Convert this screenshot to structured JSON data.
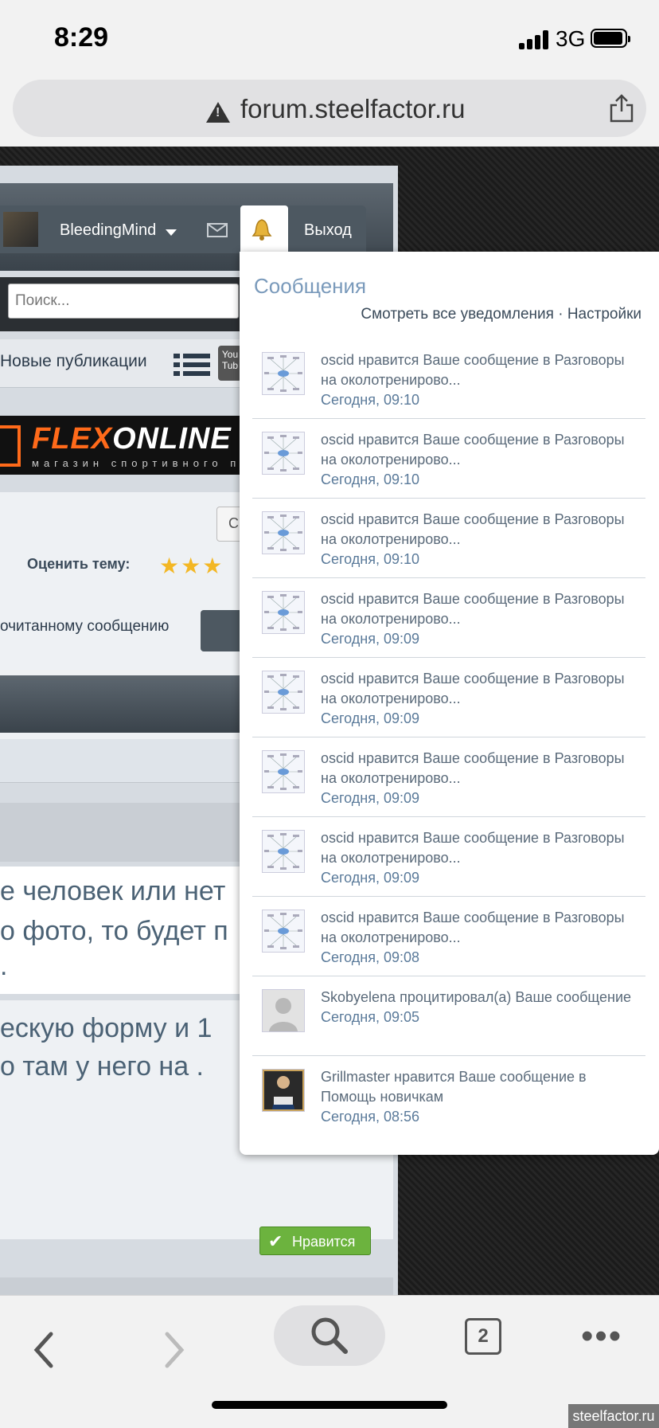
{
  "status_bar": {
    "time": "8:29",
    "network": "3G"
  },
  "browser": {
    "url": "forum.steelfactor.ru",
    "tabs_count": "2"
  },
  "site": {
    "username": "BleedingMind",
    "logout_label": "Выход",
    "search_placeholder": "Поиск...",
    "new_publications": "Новые публикации",
    "youtube_label": "You Tub",
    "banner_text_orange": "FLEX",
    "banner_text_white": "ONLINE",
    "banner_subtext": "магазин спортивного п",
    "small_button_label": "С",
    "rate_label": "Оценить тему:",
    "stars": "★★★",
    "unread_text": "очитанному сообщению",
    "post_lines": [
      "е человек или нет",
      "о фото, то будет п",
      ".",
      "ескую форму и 1",
      "о там у него на ."
    ],
    "like_label": "Нравится"
  },
  "popup": {
    "title": "Сообщения",
    "view_all": "Смотреть все уведомления",
    "separator": "·",
    "settings": "Настройки",
    "notifications": [
      {
        "user": "oscid",
        "text": "нравится Ваше сообщение в Разговоры на околотренирово...",
        "time": "Сегодня, 09:10",
        "avatar": "diagram"
      },
      {
        "user": "oscid",
        "text": "нравится Ваше сообщение в Разговоры на околотренирово...",
        "time": "Сегодня, 09:10",
        "avatar": "diagram"
      },
      {
        "user": "oscid",
        "text": "нравится Ваше сообщение в Разговоры на околотренирово...",
        "time": "Сегодня, 09:10",
        "avatar": "diagram"
      },
      {
        "user": "oscid",
        "text": "нравится Ваше сообщение в Разговоры на околотренирово...",
        "time": "Сегодня, 09:09",
        "avatar": "diagram"
      },
      {
        "user": "oscid",
        "text": "нравится Ваше сообщение в Разговоры на околотренирово...",
        "time": "Сегодня, 09:09",
        "avatar": "diagram"
      },
      {
        "user": "oscid",
        "text": "нравится Ваше сообщение в Разговоры на околотренирово...",
        "time": "Сегодня, 09:09",
        "avatar": "diagram"
      },
      {
        "user": "oscid",
        "text": "нравится Ваше сообщение в Разговоры на околотренирово...",
        "time": "Сегодня, 09:09",
        "avatar": "diagram"
      },
      {
        "user": "oscid",
        "text": "нравится Ваше сообщение в Разговоры на околотренирово...",
        "time": "Сегодня, 09:08",
        "avatar": "diagram"
      },
      {
        "user": "Skobyelena",
        "text": "процитировал(а) Ваше сообщение",
        "time": "Сегодня, 09:05",
        "avatar": "default"
      },
      {
        "user": "Grillmaster",
        "text": "нравится Ваше сообщение в Помощь новичкам",
        "time": "Сегодня, 08:56",
        "avatar": "photo"
      }
    ]
  },
  "watermark": "steelfactor.ru"
}
